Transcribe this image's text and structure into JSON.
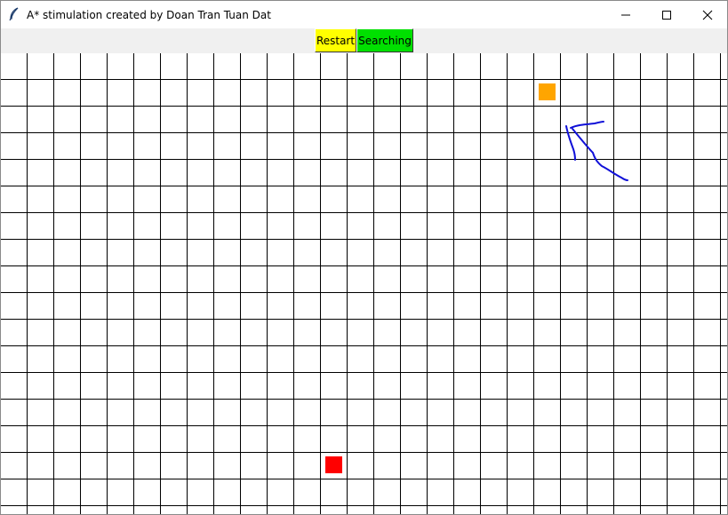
{
  "window": {
    "title": "A* stimulation created by Doan Tran Tuan Dat",
    "app_icon": "feather-icon",
    "controls": [
      "minimize-icon",
      "maximize-icon",
      "close-icon"
    ]
  },
  "toolbar": {
    "restart_label": "Restart",
    "restart_color": "#ffff00",
    "searching_label": "Searching",
    "searching_color": "#00e000"
  },
  "grid": {
    "columns": 27,
    "rows": 17,
    "line_color": "#000000",
    "background": "#ffffff",
    "start_cell": {
      "col": 20,
      "row": 1,
      "color": "#ffa500"
    },
    "end_cell": {
      "col": 12,
      "row": 15,
      "color": "#ff0000"
    },
    "annotation": {
      "type": "hand-drawn-arrow",
      "color": "#1010d8"
    }
  }
}
